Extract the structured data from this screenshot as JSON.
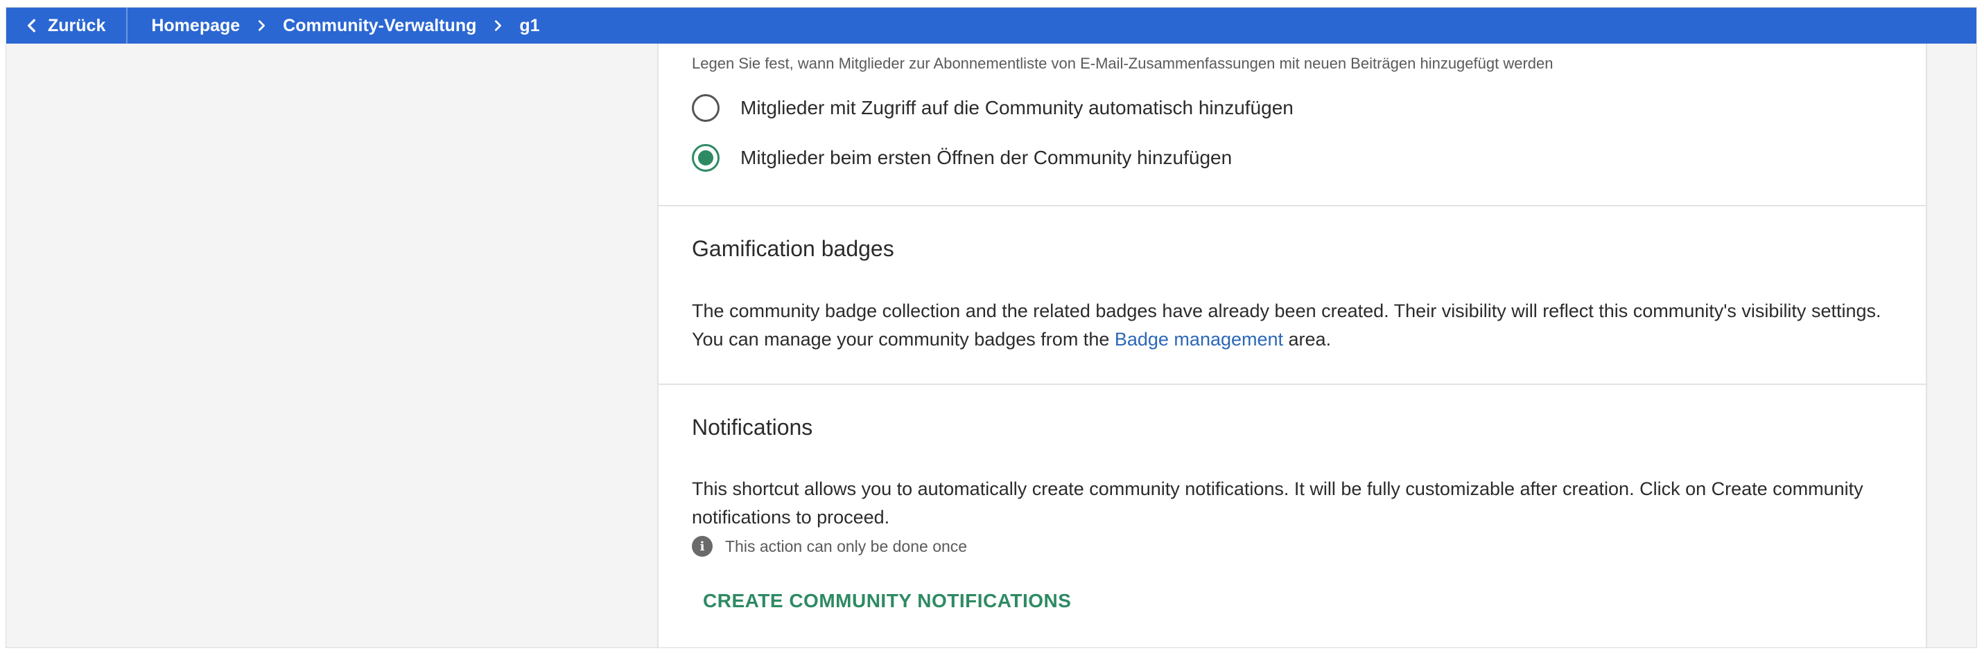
{
  "topbar": {
    "back_label": "Zurück",
    "breadcrumbs": [
      "Homepage",
      "Community-Verwaltung",
      "g1"
    ]
  },
  "subscription": {
    "hint": "Legen Sie fest, wann Mitglieder zur Abonnementliste von E-Mail-Zusammenfassungen mit neuen Beiträgen hinzugefügt werden",
    "options": [
      {
        "label": "Mitglieder mit Zugriff auf die Community automatisch hinzufügen",
        "checked": false
      },
      {
        "label": "Mitglieder beim ersten Öffnen der Community hinzufügen",
        "checked": true
      }
    ]
  },
  "gamification": {
    "title": "Gamification badges",
    "text_before": "The community badge collection and the related badges have already been created. Their visibility will reflect this community's visibility settings. You can manage your community badges from the ",
    "link": "Badge management",
    "text_after": " area."
  },
  "notifications": {
    "title": "Notifications",
    "text": "This shortcut allows you to automatically create community notifications. It will be fully customizable after creation. Click on Create community notifications to proceed.",
    "info": "This action can only be done once",
    "button": "CREATE COMMUNITY NOTIFICATIONS"
  },
  "colors": {
    "topbar": "#2b67d3",
    "accent_green": "#2e8a63",
    "link": "#2b67b7"
  },
  "icons": {
    "back": "chevron-left-icon",
    "separator": "chevron-right-icon",
    "info": "info-icon"
  }
}
